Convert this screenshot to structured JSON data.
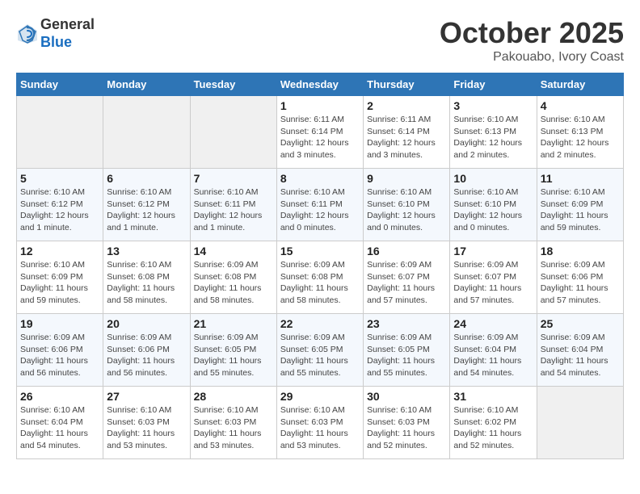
{
  "header": {
    "logo_line1": "General",
    "logo_line2": "Blue",
    "month": "October 2025",
    "location": "Pakouabo, Ivory Coast"
  },
  "weekdays": [
    "Sunday",
    "Monday",
    "Tuesday",
    "Wednesday",
    "Thursday",
    "Friday",
    "Saturday"
  ],
  "weeks": [
    [
      {
        "day": "",
        "info": ""
      },
      {
        "day": "",
        "info": ""
      },
      {
        "day": "",
        "info": ""
      },
      {
        "day": "1",
        "info": "Sunrise: 6:11 AM\nSunset: 6:14 PM\nDaylight: 12 hours and 3 minutes."
      },
      {
        "day": "2",
        "info": "Sunrise: 6:11 AM\nSunset: 6:14 PM\nDaylight: 12 hours and 3 minutes."
      },
      {
        "day": "3",
        "info": "Sunrise: 6:10 AM\nSunset: 6:13 PM\nDaylight: 12 hours and 2 minutes."
      },
      {
        "day": "4",
        "info": "Sunrise: 6:10 AM\nSunset: 6:13 PM\nDaylight: 12 hours and 2 minutes."
      }
    ],
    [
      {
        "day": "5",
        "info": "Sunrise: 6:10 AM\nSunset: 6:12 PM\nDaylight: 12 hours and 1 minute."
      },
      {
        "day": "6",
        "info": "Sunrise: 6:10 AM\nSunset: 6:12 PM\nDaylight: 12 hours and 1 minute."
      },
      {
        "day": "7",
        "info": "Sunrise: 6:10 AM\nSunset: 6:11 PM\nDaylight: 12 hours and 1 minute."
      },
      {
        "day": "8",
        "info": "Sunrise: 6:10 AM\nSunset: 6:11 PM\nDaylight: 12 hours and 0 minutes."
      },
      {
        "day": "9",
        "info": "Sunrise: 6:10 AM\nSunset: 6:10 PM\nDaylight: 12 hours and 0 minutes."
      },
      {
        "day": "10",
        "info": "Sunrise: 6:10 AM\nSunset: 6:10 PM\nDaylight: 12 hours and 0 minutes."
      },
      {
        "day": "11",
        "info": "Sunrise: 6:10 AM\nSunset: 6:09 PM\nDaylight: 11 hours and 59 minutes."
      }
    ],
    [
      {
        "day": "12",
        "info": "Sunrise: 6:10 AM\nSunset: 6:09 PM\nDaylight: 11 hours and 59 minutes."
      },
      {
        "day": "13",
        "info": "Sunrise: 6:10 AM\nSunset: 6:08 PM\nDaylight: 11 hours and 58 minutes."
      },
      {
        "day": "14",
        "info": "Sunrise: 6:09 AM\nSunset: 6:08 PM\nDaylight: 11 hours and 58 minutes."
      },
      {
        "day": "15",
        "info": "Sunrise: 6:09 AM\nSunset: 6:08 PM\nDaylight: 11 hours and 58 minutes."
      },
      {
        "day": "16",
        "info": "Sunrise: 6:09 AM\nSunset: 6:07 PM\nDaylight: 11 hours and 57 minutes."
      },
      {
        "day": "17",
        "info": "Sunrise: 6:09 AM\nSunset: 6:07 PM\nDaylight: 11 hours and 57 minutes."
      },
      {
        "day": "18",
        "info": "Sunrise: 6:09 AM\nSunset: 6:06 PM\nDaylight: 11 hours and 57 minutes."
      }
    ],
    [
      {
        "day": "19",
        "info": "Sunrise: 6:09 AM\nSunset: 6:06 PM\nDaylight: 11 hours and 56 minutes."
      },
      {
        "day": "20",
        "info": "Sunrise: 6:09 AM\nSunset: 6:06 PM\nDaylight: 11 hours and 56 minutes."
      },
      {
        "day": "21",
        "info": "Sunrise: 6:09 AM\nSunset: 6:05 PM\nDaylight: 11 hours and 55 minutes."
      },
      {
        "day": "22",
        "info": "Sunrise: 6:09 AM\nSunset: 6:05 PM\nDaylight: 11 hours and 55 minutes."
      },
      {
        "day": "23",
        "info": "Sunrise: 6:09 AM\nSunset: 6:05 PM\nDaylight: 11 hours and 55 minutes."
      },
      {
        "day": "24",
        "info": "Sunrise: 6:09 AM\nSunset: 6:04 PM\nDaylight: 11 hours and 54 minutes."
      },
      {
        "day": "25",
        "info": "Sunrise: 6:09 AM\nSunset: 6:04 PM\nDaylight: 11 hours and 54 minutes."
      }
    ],
    [
      {
        "day": "26",
        "info": "Sunrise: 6:10 AM\nSunset: 6:04 PM\nDaylight: 11 hours and 54 minutes."
      },
      {
        "day": "27",
        "info": "Sunrise: 6:10 AM\nSunset: 6:03 PM\nDaylight: 11 hours and 53 minutes."
      },
      {
        "day": "28",
        "info": "Sunrise: 6:10 AM\nSunset: 6:03 PM\nDaylight: 11 hours and 53 minutes."
      },
      {
        "day": "29",
        "info": "Sunrise: 6:10 AM\nSunset: 6:03 PM\nDaylight: 11 hours and 53 minutes."
      },
      {
        "day": "30",
        "info": "Sunrise: 6:10 AM\nSunset: 6:03 PM\nDaylight: 11 hours and 52 minutes."
      },
      {
        "day": "31",
        "info": "Sunrise: 6:10 AM\nSunset: 6:02 PM\nDaylight: 11 hours and 52 minutes."
      },
      {
        "day": "",
        "info": ""
      }
    ]
  ]
}
